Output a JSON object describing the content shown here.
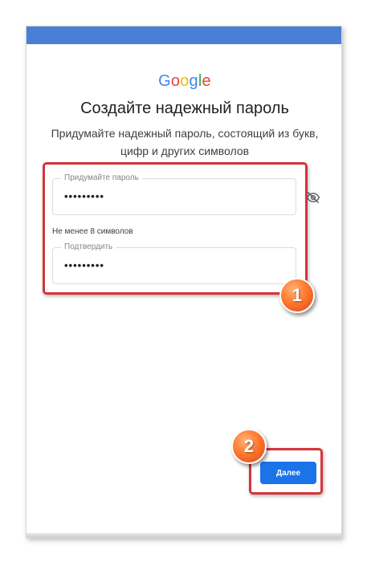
{
  "header": {
    "logo_letters": [
      "G",
      "o",
      "o",
      "g",
      "l",
      "e"
    ],
    "logo_colors": [
      "#4285F4",
      "#EA4335",
      "#FBBC05",
      "#4285F4",
      "#34A853",
      "#EA4335"
    ],
    "title": "Создайте надежный пароль",
    "subtitle_line1": "Придумайте надежный пароль, состоящий из букв,",
    "subtitle_line2": "цифр и других символов"
  },
  "form": {
    "password": {
      "label": "Придумайте пароль",
      "value": "•••••••••"
    },
    "hint": "Не менее 8 символов",
    "confirm": {
      "label": "Подтвердить",
      "value": "•••••••••"
    },
    "toggle_icon": "eye-off-icon"
  },
  "actions": {
    "next_label": "Далее"
  },
  "annotations": {
    "badge1": "1",
    "badge2": "2",
    "highlight_color": "#d4353b"
  },
  "colors": {
    "top_bar": "#4a7fd6",
    "primary_button": "#1a73e8"
  }
}
